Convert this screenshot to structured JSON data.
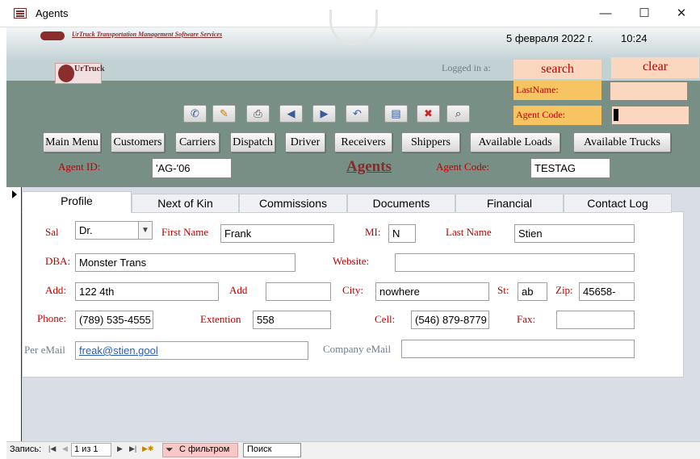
{
  "window": {
    "title": "Agents",
    "minimize": "—",
    "maximize": "☐",
    "close": "✕"
  },
  "header": {
    "company_name": "UrTruck Transportation Management Software Services",
    "logo_text": "UrTruck",
    "date": "5 февраля 2022 г.",
    "time": "10:24",
    "logged_in_label": "Logged in a:"
  },
  "search": {
    "search_label": "search",
    "clear_label": "clear",
    "lastname_label": "LastName:",
    "agentcode_label": "Agent Code:",
    "lastname_value": "",
    "agentcode_value": ""
  },
  "toolbar": {
    "icons": [
      "phone-icon",
      "pencil-icon",
      "print-icon",
      "prev-record-icon",
      "next-record-icon",
      "undo-icon",
      "report-icon",
      "delete-icon",
      "find-icon"
    ]
  },
  "nav": {
    "main_menu": "Main Menu",
    "customers": "Customers",
    "carriers": "Carriers",
    "dispatch": "Dispatch",
    "driver": "Driver",
    "receivers": "Receivers",
    "shippers": "Shippers",
    "available_loads": "Available Loads",
    "available_trucks": "Available Trucks"
  },
  "agent": {
    "id_label": "Agent ID:",
    "id_value": "'AG-'06",
    "title": "Agents",
    "code_label": "Agent Code:",
    "code_value": "TESTAG"
  },
  "tabs": {
    "profile": "Profile",
    "next_of_kin": "Next of Kin",
    "commissions": "Commissions",
    "documents": "Documents",
    "financial": "Financial",
    "contact_log": "Contact Log"
  },
  "profile": {
    "sal_label": "Sal",
    "sal_value": "Dr.",
    "first_name_label": "First Name",
    "first_name_value": "Frank",
    "mi_label": "MI:",
    "mi_value": "N",
    "last_name_label": "Last Name",
    "last_name_value": "Stien",
    "dba_label": "DBA:",
    "dba_value": "Monster Trans",
    "website_label": "Website:",
    "website_value": "",
    "add_label": "Add:",
    "add_value": "122 4th",
    "add2_label": "Add",
    "add2_value": "",
    "city_label": "City:",
    "city_value": "nowhere",
    "st_label": "St:",
    "st_value": "ab",
    "zip_label": "Zip:",
    "zip_value": "45658-",
    "phone_label": "Phone:",
    "phone_value": "(789) 535-4555",
    "extention_label": "Extention",
    "extention_value": "558",
    "cell_label": "Cell:",
    "cell_value": "(546) 879-8779",
    "fax_label": "Fax:",
    "fax_value": "",
    "per_email_label": "Per eMail",
    "per_email_value": "freak@stien.gool",
    "company_email_label": "Company eMail",
    "company_email_value": ""
  },
  "statusbar": {
    "record_label": "Запись:",
    "record_value": "1 из 1",
    "filter_label": "С фильтром",
    "search_placeholder": "Поиск"
  }
}
